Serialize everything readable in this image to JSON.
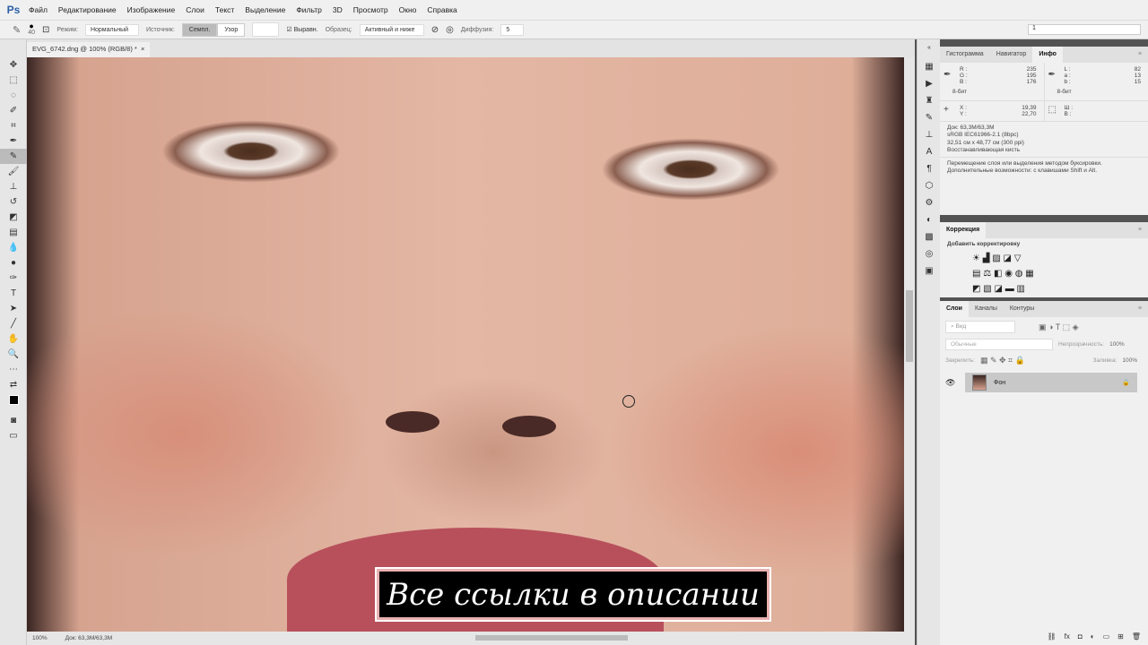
{
  "app": {
    "logo": "Ps"
  },
  "menu": [
    "Файл",
    "Редактирование",
    "Изображение",
    "Слои",
    "Текст",
    "Выделение",
    "Фильтр",
    "3D",
    "Просмотр",
    "Окно",
    "Справка"
  ],
  "options": {
    "brush_size": "40",
    "mode_label": "Режим:",
    "mode_value": "Нормальный",
    "source_label": "Источник:",
    "source_sampled": "Семпл.",
    "source_pattern": "Узор",
    "aligned_label": "Выравн.",
    "sample_label": "Образец:",
    "sample_value": "Активный и ниже",
    "diffusion_label": "Диффузия:",
    "diffusion_value": "5",
    "top_field": "1"
  },
  "document": {
    "tab_title": "EVG_6742.dng @ 100% (RGB/8) *",
    "close": "×"
  },
  "status": {
    "zoom": "100%",
    "doc": "Док: 63,3M/63,3M"
  },
  "banner": {
    "text": "Все ссылки в описании"
  },
  "info_panel": {
    "tabs": [
      "Гистограмма",
      "Навигатор",
      "Инфо"
    ],
    "rgb": [
      [
        "R :",
        "235"
      ],
      [
        "G :",
        "195"
      ],
      [
        "B :",
        "176"
      ]
    ],
    "rgb_bits": "8-бит",
    "lab": [
      [
        "L :",
        "82"
      ],
      [
        "a :",
        "13"
      ],
      [
        "b :",
        "15"
      ]
    ],
    "lab_bits": "8-бит",
    "xy": [
      [
        "X :",
        "19,39"
      ],
      [
        "Y :",
        "22,70"
      ]
    ],
    "wh": [
      [
        "Ш :",
        ""
      ],
      [
        "В :",
        ""
      ]
    ],
    "doc_lines": [
      "Док: 63,3M/63,3M",
      "sRGB IEC61966-2.1 (8bpc)",
      "32,51 см x 48,77 см (300 ppi)",
      "Восстанавливающая кисть"
    ],
    "hint": [
      "Перемещение слоя или выделения методом буксировки.",
      "Дополнительные возможности: с клавишами Shift и Alt."
    ]
  },
  "correction_panel": {
    "title": "Коррекция",
    "subtitle": "Добавить корректировку"
  },
  "layers_panel": {
    "tabs": [
      "Слои",
      "Каналы",
      "Контуры"
    ],
    "filter_placeholder": "Вид",
    "blend": "Обычные",
    "opacity_label": "Непрозрачность:",
    "opacity": "100%",
    "lock_label": "Закрепить:",
    "fill_label": "Заливка:",
    "fill": "100%",
    "layers": [
      {
        "name": "Фон",
        "visible": true,
        "locked": true
      }
    ]
  }
}
